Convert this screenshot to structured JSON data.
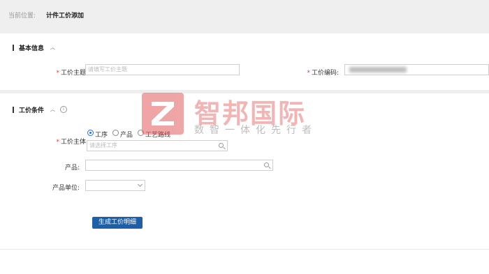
{
  "breadcrumb": {
    "label": "当前位置:",
    "current": "计件工价添加"
  },
  "basic_section": {
    "title": "基本信息",
    "subject_label": "工价主题:",
    "subject_placeholder": "请填写工价主题",
    "code_label": "工价编码:"
  },
  "condition_section": {
    "title": "工价条件",
    "body_label": "工价主体:",
    "radio_options": [
      "工序",
      "产品",
      "工艺路线"
    ],
    "selected_option": "工序",
    "process_placeholder": "请选择工序",
    "product_label": "产品:",
    "unit_label": "产品单位:"
  },
  "actions": {
    "generate_label": "生成工价明细"
  },
  "watermark": {
    "title": "智邦国际",
    "subtitle": "数智一体化先行者",
    "color": "#e25c5c"
  },
  "colors": {
    "accent": "#1f5fa8",
    "required": "#e23b3b",
    "radio_selected": "#2e6ed6"
  },
  "icons": [
    "chevron-up-icon",
    "info-icon",
    "search-icon",
    "chevron-down-icon",
    "logo-z-icon"
  ]
}
